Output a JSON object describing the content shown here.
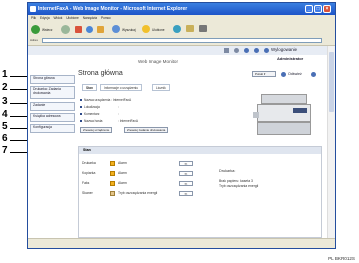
{
  "window": {
    "title": "InternetFaxA - Web Image Monitor - Microsoft Internet Explorer"
  },
  "menu": [
    "Plik",
    "Edycja",
    "Widok",
    "Ulubione",
    "Narzędzia",
    "Pomoc"
  ],
  "toolbar": {
    "back_label": "Wstecz",
    "search_label": "Wyszukaj",
    "favorites_label": "Ulubione"
  },
  "address": {
    "label": "Adres",
    "go_label": "Łącza"
  },
  "wim": {
    "banner": "Web Image Monitor",
    "logout_label": "Wylogowanie",
    "user": "Administrator"
  },
  "nav": {
    "items": [
      "Strona główna",
      "Drukarka: Zadania drukowania",
      "Zadanie",
      "Książka adresowa",
      "Konfiguracja"
    ]
  },
  "page": {
    "title": "Strona główna",
    "language": "Polski",
    "refresh_label": "Odśwież"
  },
  "tabs": [
    "Stan",
    "Informacje o urządzeniu",
    "Licznik"
  ],
  "device": {
    "rows": [
      {
        "label": "Nazwa urządzenia",
        "value": ": InternetFaxA"
      },
      {
        "label": "Lokalizacja",
        "value": ":"
      },
      {
        "label": "Komentarz",
        "value": ":"
      },
      {
        "label": "Nazwa hosta",
        "value": ": InternetFaxA"
      }
    ],
    "reset_device_label": "Zresetuj urządzenie",
    "reset_print_label": "Zresetuj zadanie drukowania"
  },
  "status": {
    "header": "Stan",
    "rows": [
      {
        "label": "Drukarka",
        "value": "Alarm"
      },
      {
        "label": "Kopiarka",
        "value": "Alarm"
      },
      {
        "label": "Faks",
        "value": "Alarm"
      },
      {
        "label": "Skaner",
        "value": "Tryb oszczędzania energii"
      }
    ],
    "side_title": "Drukarka:",
    "side_lines": [
      "Brak papieru: kaseta 3",
      "Tryb oszczędzania energii"
    ]
  },
  "callouts": [
    "1",
    "2",
    "3",
    "4",
    "5",
    "6",
    "7"
  ],
  "figure_code": "PL BKR012S"
}
